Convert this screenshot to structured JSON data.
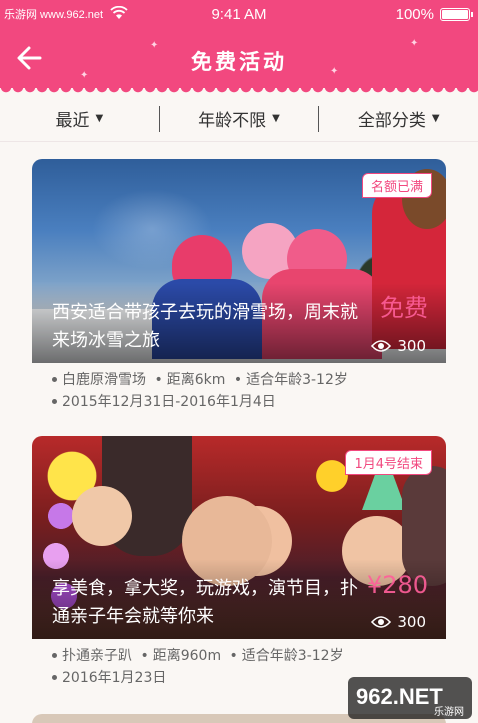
{
  "status_bar": {
    "watermark": "乐游网 www.962.net",
    "time": "9:41 AM",
    "battery": "100%"
  },
  "header": {
    "title": "免费活动"
  },
  "filters": [
    {
      "label": "最近"
    },
    {
      "label": "年龄不限"
    },
    {
      "label": "全部分类"
    }
  ],
  "activities": [
    {
      "badge": "名额已满",
      "title": "西安适合带孩子去玩的滑雪场，周末就来场冰雪之旅",
      "price": "免费",
      "views": "300",
      "location": "白鹿原滑雪场",
      "distance": "距离6km",
      "age": "适合年龄3-12岁",
      "date": "2015年12月31日-2016年1月4日"
    },
    {
      "badge": "1月4号结束",
      "title": "享美食，拿大奖，玩游戏，演节目，扑通亲子年会就等你来",
      "price": "¥280",
      "views": "300",
      "location": "扑通亲子趴",
      "distance": "距离960m",
      "age": "适合年龄3-12岁",
      "date": "2016年1月23日"
    }
  ],
  "watermark_logo": {
    "text": "962.NET",
    "subtext": "乐游网"
  },
  "colors": {
    "brand": "#f2487f",
    "price": "#ff5f9a"
  }
}
